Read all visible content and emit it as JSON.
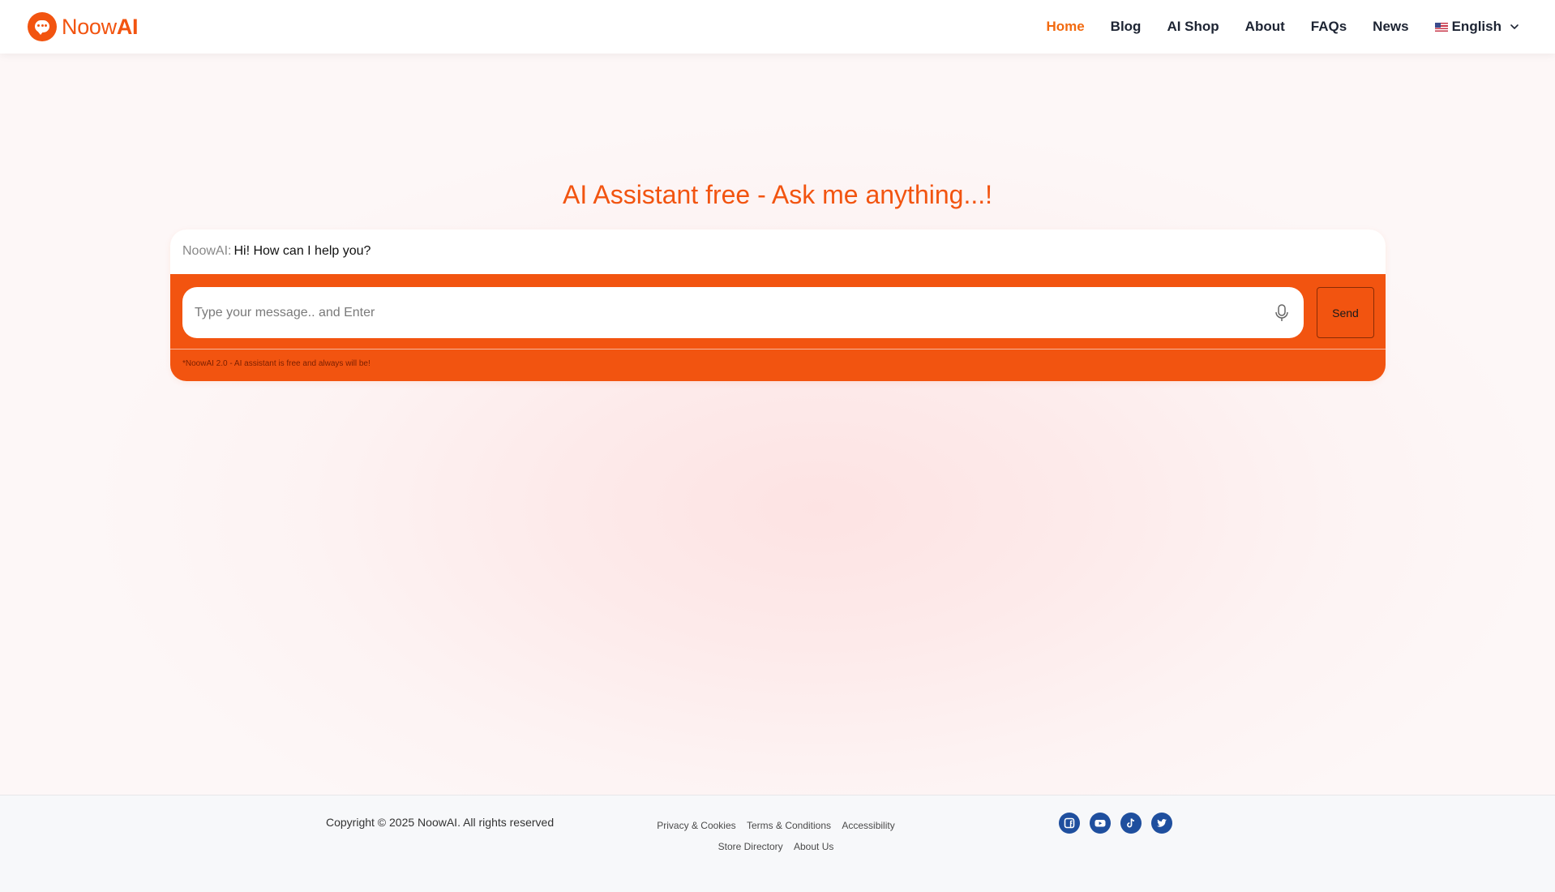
{
  "header": {
    "logo": {
      "text_light": "Noow",
      "text_bold": "AI",
      "icon": "chat-bubble-icon"
    },
    "nav": [
      {
        "label": "Home",
        "active": true
      },
      {
        "label": "Blog",
        "active": false
      },
      {
        "label": "AI Shop",
        "active": false
      },
      {
        "label": "About",
        "active": false
      },
      {
        "label": "FAQs",
        "active": false
      },
      {
        "label": "News",
        "active": false
      }
    ],
    "language": {
      "label": "English",
      "flag": "us-flag-icon"
    }
  },
  "hero": {
    "title": "AI Assistant free - Ask me anything...!"
  },
  "chat": {
    "messages": [
      {
        "sender": "NoowAI:",
        "text": "Hi! How can I help you?"
      }
    ],
    "input": {
      "value": "",
      "placeholder": "Type your message.. and Enter"
    },
    "send_label": "Send",
    "note": "*NoowAI 2.0 - AI assistant is free and always will be!"
  },
  "footer": {
    "copyright": "Copyright © 2025 NoowAI. All rights reserved",
    "links_row1": [
      "Privacy & Cookies",
      "Terms & Conditions",
      "Accessibility"
    ],
    "links_row2": [
      "Store Directory",
      "About Us"
    ],
    "socials": [
      "facebook-icon",
      "youtube-icon",
      "tiktok-icon",
      "twitter-icon"
    ]
  },
  "colors": {
    "brand": "#f25410",
    "nav_active": "#f26a10",
    "nav_text": "#1d2433",
    "social_bg": "#1f4f9e"
  }
}
